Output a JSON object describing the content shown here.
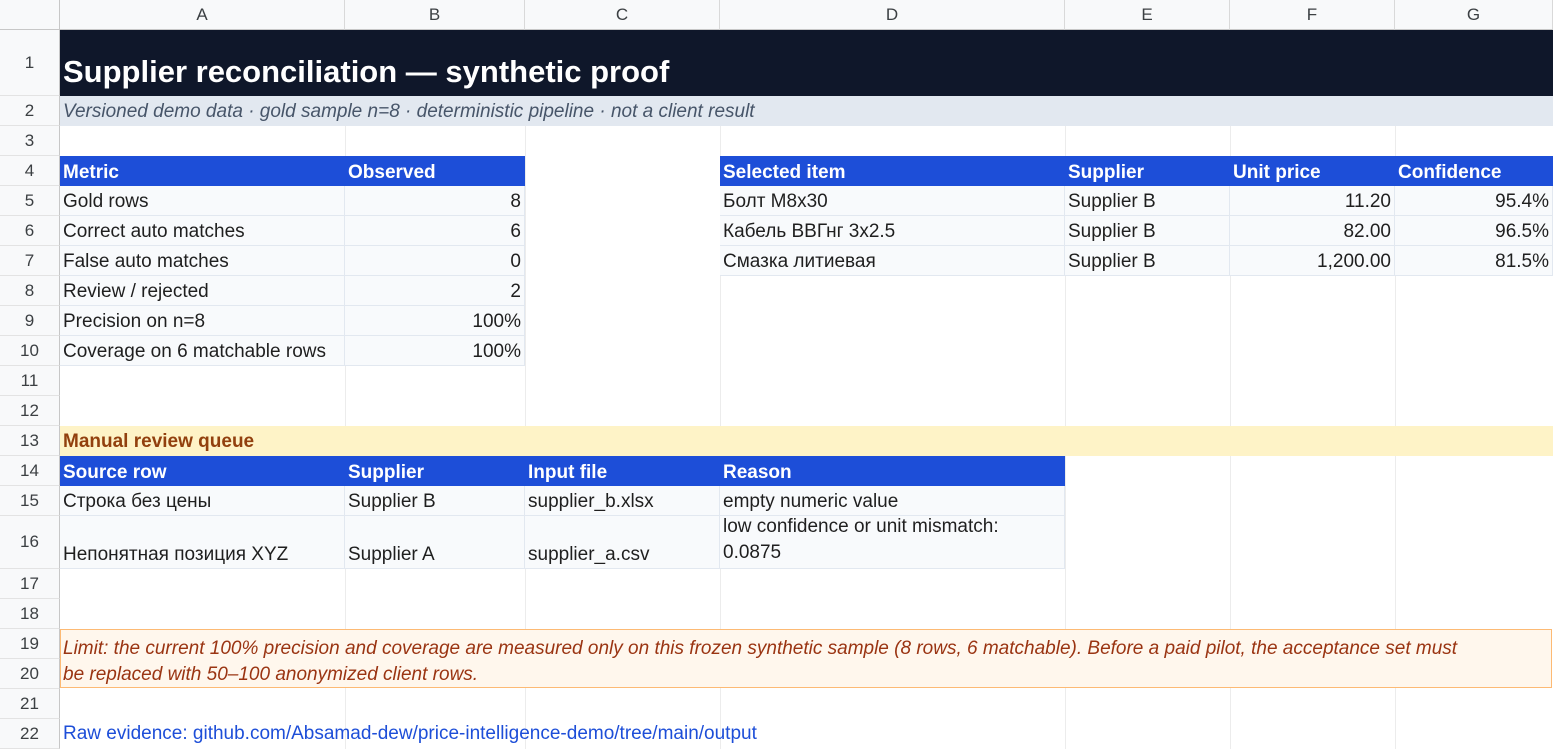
{
  "columns": [
    "A",
    "B",
    "C",
    "D",
    "E",
    "F",
    "G"
  ],
  "rows": [
    "1",
    "2",
    "3",
    "4",
    "5",
    "6",
    "7",
    "8",
    "9",
    "10",
    "11",
    "12",
    "13",
    "14",
    "15",
    "16",
    "17",
    "18",
    "19",
    "20",
    "21",
    "22"
  ],
  "title": "Supplier reconciliation — synthetic proof",
  "subtitle": "Versioned demo data · gold sample n=8 · deterministic pipeline · not a client result",
  "metrics": {
    "headers": [
      "Metric",
      "Observed"
    ],
    "rows": [
      {
        "metric": "Gold rows",
        "observed": "8"
      },
      {
        "metric": "Correct auto matches",
        "observed": "6"
      },
      {
        "metric": "False auto matches",
        "observed": "0"
      },
      {
        "metric": "Review / rejected",
        "observed": "2"
      },
      {
        "metric": "Precision on n=8",
        "observed": "100%"
      },
      {
        "metric": "Coverage on 6 matchable rows",
        "observed": "100%"
      }
    ]
  },
  "selected": {
    "headers": [
      "Selected item",
      "Supplier",
      "Unit price",
      "Confidence"
    ],
    "rows": [
      {
        "item": "Болт М8х30",
        "supplier": "Supplier B",
        "price": "11.20",
        "confidence": "95.4%"
      },
      {
        "item": "Кабель ВВГнг 3х2.5",
        "supplier": "Supplier B",
        "price": "82.00",
        "confidence": "96.5%"
      },
      {
        "item": "Смазка литиевая",
        "supplier": "Supplier B",
        "price": "1,200.00",
        "confidence": "81.5%"
      }
    ]
  },
  "review": {
    "title": "Manual review queue",
    "headers": [
      "Source row",
      "Supplier",
      "Input file",
      "Reason"
    ],
    "rows": [
      {
        "source": "Строка без цены",
        "supplier": "Supplier B",
        "file": "supplier_b.xlsx",
        "reason_line1": "empty numeric value",
        "reason_line2": ""
      },
      {
        "source": "Непонятная позиция XYZ",
        "supplier": "Supplier A",
        "file": "supplier_a.csv",
        "reason_line1": "low confidence or unit mismatch:",
        "reason_line2": "0.0875"
      }
    ]
  },
  "limit_line1": "Limit: the current 100% precision and coverage are measured only on this frozen synthetic sample (8 rows, 6 matchable). Before a paid pilot, the acceptance set must",
  "limit_line2": "be replaced with 50–100 anonymized client rows.",
  "evidence": "Raw evidence: github.com/Absamad-dew/price-intelligence-demo/tree/main/output",
  "colors": {
    "title_bg": "#0f172a",
    "header_bg": "#1d4ed8",
    "subtitle_bg": "#e2e8f0",
    "queue_bg": "#fef3c7",
    "limit_bg": "#fff7ed",
    "link": "#1d4ed8"
  }
}
